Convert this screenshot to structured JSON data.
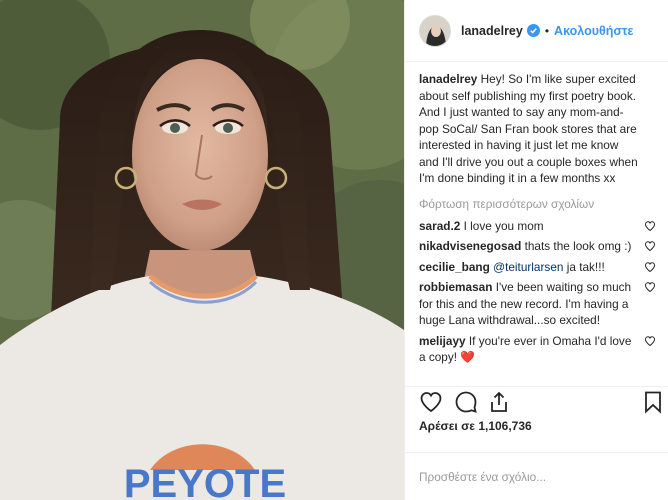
{
  "post": {
    "username": "lanadelrey",
    "separator": "•",
    "follow_label": "Ακολουθήστε",
    "shirt_text": "PEYOTE"
  },
  "caption": {
    "username": "lanadelrey",
    "text": "Hey! So I'm like super excited about self publishing my first poetry book. And I just wanted to say any mom-and-pop SoCal/ San Fran book stores that are interested in having it just let me know and I'll drive you out a couple boxes when I'm done binding it in a few months xx"
  },
  "load_more_label": "Φόρτωση περισσότερων σχολίων",
  "comments": [
    {
      "username": "sarad.2",
      "text": "I love you mom"
    },
    {
      "username": "nikadvisenegosad",
      "text": "thats the look omg :)"
    },
    {
      "username": "cecilie_bang",
      "mention": "@teiturlarsen",
      "text": "ja tak!!!"
    },
    {
      "username": "robbiemasan",
      "text": "I've been waiting so much for this and the new record. I'm having a huge Lana withdrawal...so excited!"
    },
    {
      "username": "melijayy",
      "text": "If you're ever in Omaha I'd love a copy!",
      "emoji": "❤️"
    }
  ],
  "likes_text": "Αρέσει σε 1,106,736",
  "add_comment_placeholder": "Προσθέστε ένα σχόλιο...",
  "icons": [
    "verified-badge-icon",
    "heart-icon",
    "comment-icon",
    "share-icon",
    "bookmark-icon",
    "like-comment-icon"
  ],
  "colors": {
    "accent": "#3897f0",
    "text": "#262626",
    "muted": "#999999",
    "divider": "#efefef",
    "emoji_heart": "#e0245e"
  }
}
